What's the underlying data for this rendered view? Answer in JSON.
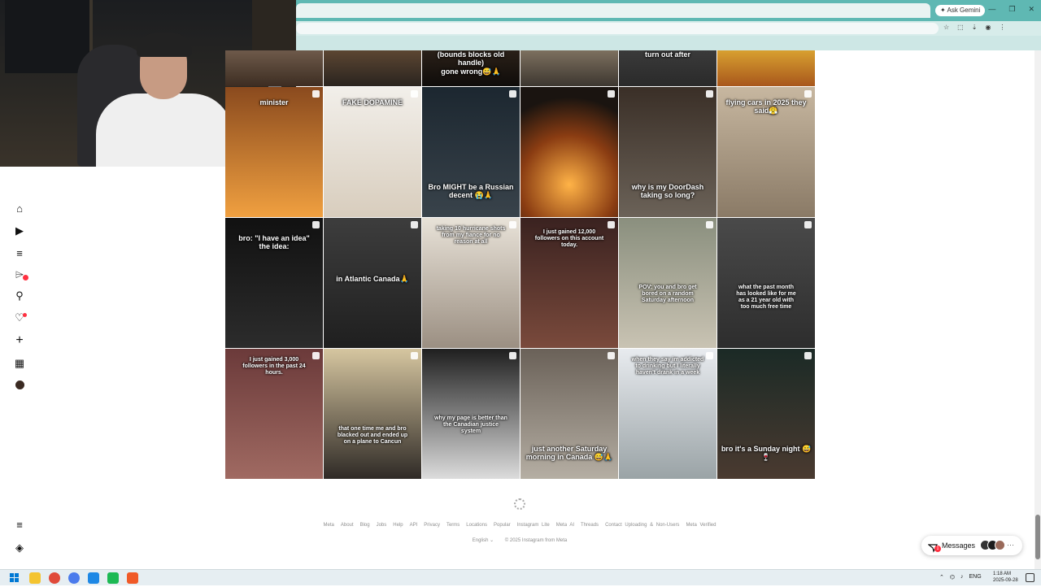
{
  "browser": {
    "ask_gemini": "Ask Gemini",
    "window_controls": [
      "—",
      "❐",
      "✕"
    ],
    "toolbar_icons": [
      "bookmark-icon",
      "extensions-icon",
      "profile-icon",
      "menu-icon"
    ]
  },
  "sidebar": {
    "items": [
      {
        "name": "home",
        "icon": "⌂"
      },
      {
        "name": "reels",
        "icon": "▶"
      },
      {
        "name": "feed",
        "icon": "≡"
      },
      {
        "name": "messages",
        "icon": "⌲",
        "badge": true
      },
      {
        "name": "search",
        "icon": "⚲"
      },
      {
        "name": "notifications",
        "icon": "♡",
        "badge": true
      },
      {
        "name": "create",
        "icon": "+"
      },
      {
        "name": "dashboard",
        "icon": "▦"
      },
      {
        "name": "profile",
        "icon": "●"
      }
    ],
    "more_icon": "≡",
    "meta_icon": "◈"
  },
  "grid": {
    "cells": [
      {
        "caption": "",
        "bg": "linear-gradient(#6e5a4a,#3d2d22)"
      },
      {
        "caption": "",
        "bg": "linear-gradient(#5c4632,#2a241f)"
      },
      {
        "caption": "(bounds blocks old handle)\ngone wrong😅🙏",
        "bg": "linear-gradient(#2a2018,#0f0c0a)"
      },
      {
        "caption": "",
        "bg": "linear-gradient(#7d705f,#3d3730)"
      },
      {
        "caption": "turn out after",
        "bg": "linear-gradient(#3a3a3a,#2a2a2a)"
      },
      {
        "caption": "",
        "bg": "linear-gradient(#d8a030,#a8571c)"
      },
      {
        "caption": "minister",
        "bg": "linear-gradient(#8a4a1e,#f0a040)"
      },
      {
        "caption": "FAKE DOPAMINE",
        "bg": "linear-gradient(#f2efea,#d8cdbd)"
      },
      {
        "caption": "Bro MIGHT be a Russian decent 😭🙏",
        "bg": "linear-gradient(#1c2730,#39434b)"
      },
      {
        "caption": "",
        "bg": "radial-gradient(circle at 50% 75%,#ffb347,#8a3c12 45%,#1a1410 80%)"
      },
      {
        "caption": "why is my DoorDash taking so long?",
        "bg": "linear-gradient(#3a2f27,#6b6258)"
      },
      {
        "caption": "flying cars in 2025 they said😤",
        "bg": "linear-gradient(#c7b7a0,#8a7a66)"
      },
      {
        "caption": "bro: \"I have an idea\"\nthe idea:",
        "bg": "linear-gradient(#111,#2c2c2c)"
      },
      {
        "caption": "in Atlantic Canada🙏",
        "bg": "linear-gradient(#3d3d3d,#1f1f1f)"
      },
      {
        "caption": "taking 10 hurricane shots\nfrom my fiance for no\nreason at all",
        "bg": "linear-gradient(#e8e2d8,#9b8f82)"
      },
      {
        "caption": "I just gained 12,000\nfollowers on this account\ntoday.",
        "bg": "linear-gradient(#3a2220,#7a4a3c)"
      },
      {
        "caption": "POV: you and bro get\nbored on a random\nSaturday afternoon",
        "bg": "linear-gradient(#8a8f7e,#c9c3b3)"
      },
      {
        "caption": "what the past month\nhas looked like for me\nas a 21 year old with\ntoo much free time",
        "bg": "linear-gradient(#4a4a4a,#2d2d2d)"
      },
      {
        "caption": "I just gained 3,000\nfollowers in the past 24\nhours.",
        "bg": "linear-gradient(#6b3a3a,#a06a62)"
      },
      {
        "caption": "that one time me and bro\nblacked out and ended up\non a plane to Cancun",
        "bg": "linear-gradient(#d6c6a0,#2f2a26)"
      },
      {
        "caption": "why my page is better than\nthe Canadian justice\nsystem",
        "bg": "linear-gradient(#1f1f1f,#dcdcdc)"
      },
      {
        "caption": "just another Saturday morning in Canada 😅🙏",
        "bg": "linear-gradient(#6a6158,#b5aea3)"
      },
      {
        "caption": "when they say im addicted\nto drinking but I literally\nhaven't drank in a week",
        "bg": "linear-gradient(#e8ebef,#9aa3a6)"
      },
      {
        "caption": "bro it's a Sunday night 😅🍷",
        "bg": "linear-gradient(#1b2a26,#4a3a30)"
      }
    ]
  },
  "footer": {
    "links": [
      "Meta",
      "About",
      "Blog",
      "Jobs",
      "Help",
      "API",
      "Privacy",
      "Terms",
      "Locations",
      "Popular",
      "Instagram Lite",
      "Meta AI",
      "Threads",
      "Contact Uploading & Non-Users",
      "Meta Verified"
    ],
    "language": "English ⌄",
    "copyright": "© 2025 Instagram from Meta"
  },
  "messages": {
    "label": "Messages",
    "badge": "1"
  },
  "taskbar": {
    "apps": [
      "#0078d4",
      "#f4c430",
      "#e04a3a",
      "#4b7bec",
      "#1e88e5",
      "#1db954",
      "#f05a28"
    ],
    "tray_text": "ENG",
    "time": "1:18 AM",
    "date": "2025-09-28"
  }
}
